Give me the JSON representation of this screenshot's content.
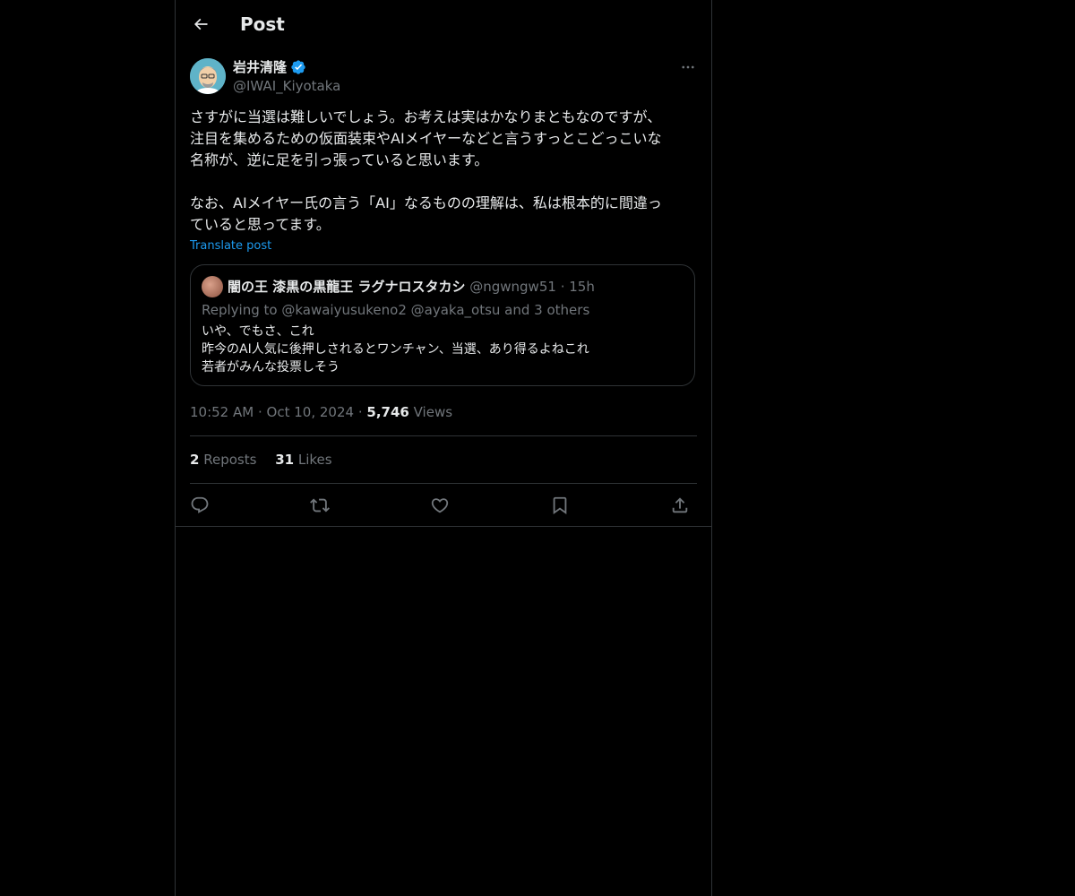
{
  "header": {
    "title": "Post",
    "back_icon": "arrow-left-icon"
  },
  "author": {
    "name": "岩井清隆",
    "handle": "@IWAI_Kiyotaka",
    "verified_icon": "verified-badge-icon",
    "more_icon": "more-horizontal-icon"
  },
  "post": {
    "text": "さすがに当選は難しいでしょう。お考えは実はかなりまともなのですが、\n注目を集めるための仮面装束やAIメイヤーなどと言うすっとこどっこいな\n名称が、逆に足を引っ張っていると思います。\n\nなお、AIメイヤー氏の言う「AI」なるものの理解は、私は根本的に間違っ\nていると思ってます。",
    "translate_label": "Translate post"
  },
  "quote": {
    "name": "闇の王 漆黒の黒龍王 ラグナロスタカシ",
    "handle": "@ngwngw51",
    "dot": "·",
    "time": "15h",
    "replying": "Replying to @kawaiyusukeno2 @ayaka_otsu and 3 others",
    "lines": [
      "いや、でもさ、これ",
      "昨今のAI人気に後押しされるとワンチャン、当選、あり得るよねこれ",
      "若者がみんな投票しそう"
    ]
  },
  "meta": {
    "time": "10:52 AM",
    "dot1": "·",
    "date": "Oct 10, 2024",
    "dot2": "·",
    "views_count": "5,746",
    "views_label": "Views"
  },
  "stats": {
    "reposts_count": "2",
    "reposts_label": "Reposts",
    "likes_count": "31",
    "likes_label": "Likes"
  },
  "actions": [
    {
      "icon": "reply-icon"
    },
    {
      "icon": "repost-icon"
    },
    {
      "icon": "like-heart-icon"
    },
    {
      "icon": "bookmark-icon"
    },
    {
      "icon": "share-icon"
    }
  ],
  "colors": {
    "background": "#000000",
    "text_primary": "#e7e9ea",
    "text_secondary": "#71767b",
    "accent": "#1d9bf0",
    "border": "#2f3336"
  }
}
